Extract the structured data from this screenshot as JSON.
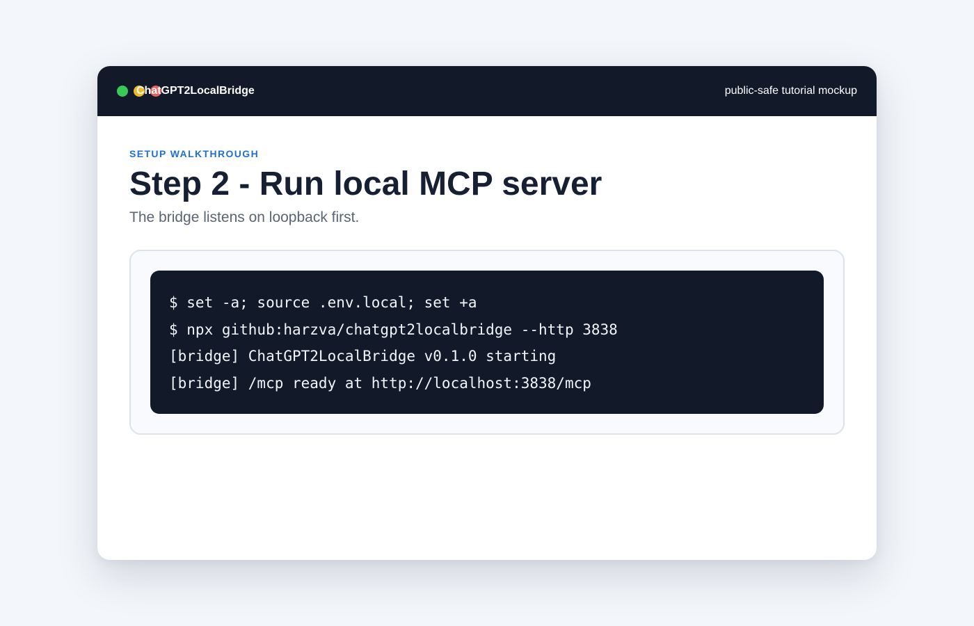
{
  "window": {
    "title": "ChatGPT2LocalBridge",
    "tag": "public-safe tutorial mockup",
    "controls": [
      {
        "name": "green-window-dot",
        "color": "#38c956"
      },
      {
        "name": "yellow-window-dot",
        "color": "#f2b82b"
      },
      {
        "name": "red-window-dot",
        "color": "#ec5e5e"
      }
    ]
  },
  "page": {
    "eyebrow": "SETUP WALKTHROUGH",
    "heading": "Step 2 - Run local MCP server",
    "lead": "The bridge listens on loopback first."
  },
  "terminal": {
    "lines": [
      "$ set -a; source .env.local; set +a",
      "$ npx github:harzva/chatgpt2localbridge --http 3838",
      "[bridge] ChatGPT2LocalBridge v0.1.0 starting",
      "[bridge] /mcp ready at http://localhost:3838/mcp"
    ]
  },
  "colors": {
    "accent": "#1f6fd6",
    "titlebar": "#121a2a",
    "terminal_bg": "#121a2a",
    "heading_text": "#172033"
  }
}
